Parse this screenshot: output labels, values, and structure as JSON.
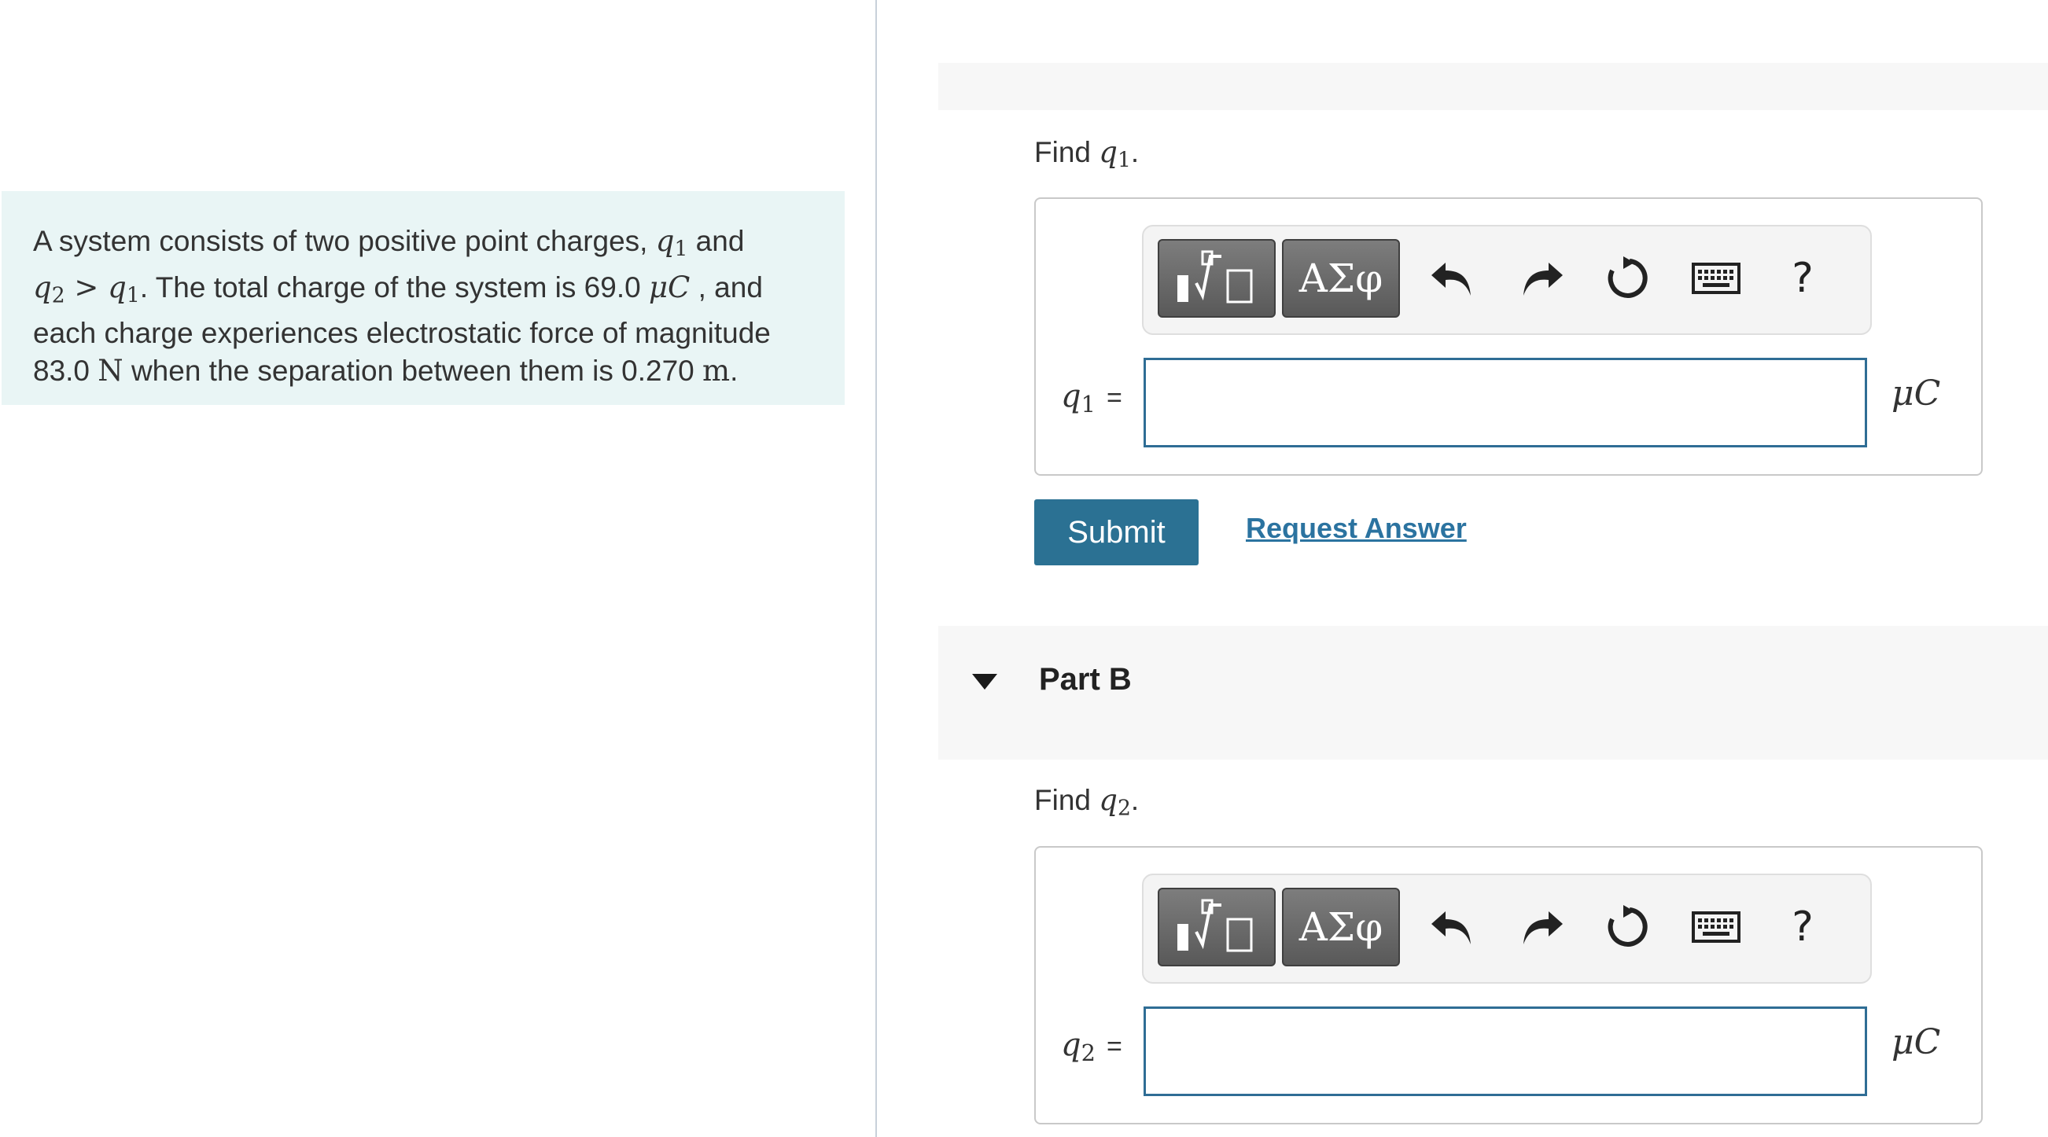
{
  "problem": {
    "text_1": "A system consists of two positive point charges, ",
    "q1": "q",
    "q1_sub": "1",
    "text_2": " and",
    "q2": "q",
    "q2_sub": "2",
    "gt": " > ",
    "q1b": "q",
    "q1b_sub": "1",
    "text_3": ". The total charge of the system is 69.0 ",
    "unit_charge": "μC",
    "text_4": " , and each charge experiences electrostatic force of magnitude 83.0 ",
    "unit_force": "N",
    "text_5": " when the separation between them is 0.270 ",
    "unit_length": "m",
    "text_6": "."
  },
  "part_a": {
    "find_prefix": "Find ",
    "find_var": "q",
    "find_sub": "1",
    "find_suffix": ".",
    "var": "q",
    "var_sub": "1",
    "equals": "=",
    "input_value": "",
    "unit": "μC",
    "submit_label": "Submit",
    "request_answer_label": "Request Answer"
  },
  "part_b": {
    "title": "Part B",
    "find_prefix": "Find ",
    "find_var": "q",
    "find_sub": "2",
    "find_suffix": ".",
    "var": "q",
    "var_sub": "2",
    "equals": "=",
    "input_value": "",
    "unit": "μC"
  },
  "toolbar": {
    "greek_label": "ΑΣφ",
    "help_label": "?",
    "icons": [
      "templates-icon",
      "greek-letters-icon",
      "undo-icon",
      "redo-icon",
      "reset-icon",
      "keyboard-icon",
      "help-icon"
    ]
  }
}
